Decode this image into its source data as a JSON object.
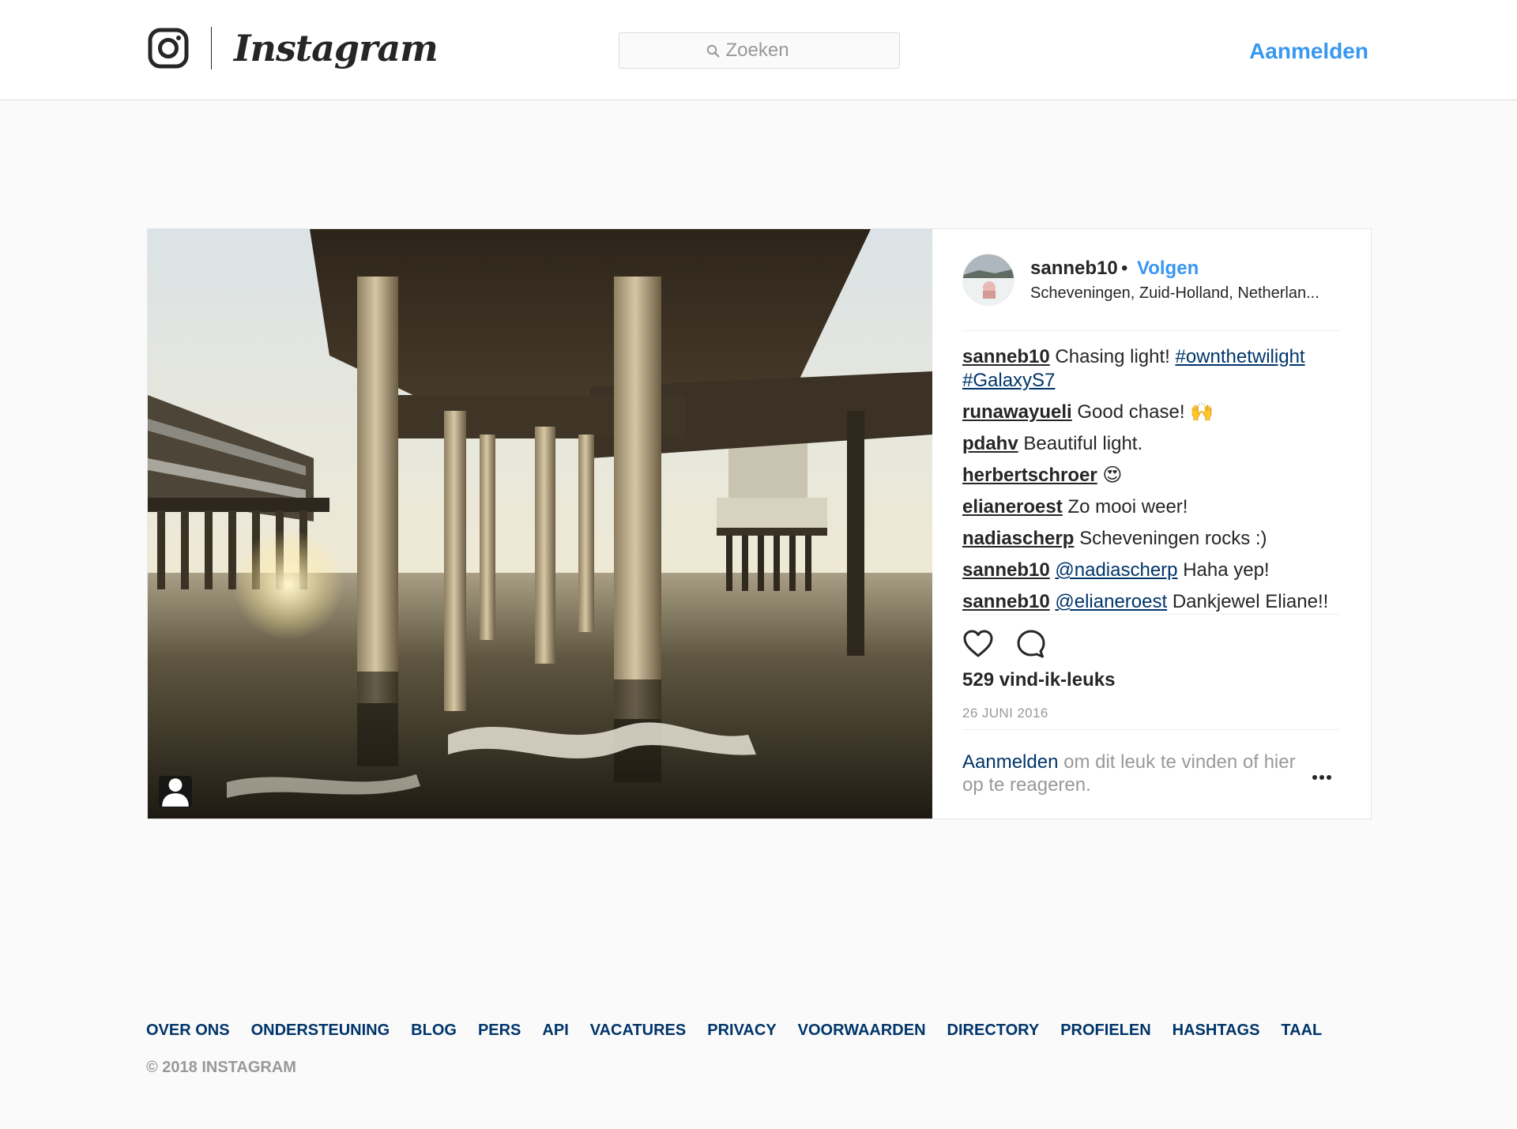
{
  "header": {
    "logo_text": "Instagram",
    "search_placeholder": "Zoeken",
    "login_label": "Aanmelden"
  },
  "post": {
    "username": "sanneb10",
    "separator": "•",
    "follow_label": "Volgen",
    "location": "Scheveningen, Zuid-Holland, Netherlan...",
    "comments": [
      {
        "user": "sanneb10",
        "text": "Chasing light!",
        "tags": [
          "#ownthetwilight",
          "#GalaxyS7"
        ]
      },
      {
        "user": "runawayueli",
        "text": "Good chase! 🙌"
      },
      {
        "user": "pdahv",
        "text": "Beautiful light."
      },
      {
        "user": "herbertschroer",
        "text": "😍"
      },
      {
        "user": "elianeroest",
        "text": "Zo mooi weer!"
      },
      {
        "user": "nadiascherp",
        "text": "Scheveningen rocks :)"
      },
      {
        "user": "sanneb10",
        "mention": "@nadiascherp",
        "text": "Haha yep!"
      },
      {
        "user": "sanneb10",
        "mention": "@elianeroest",
        "text": "Dankjewel Eliane!!"
      }
    ],
    "likes": "529 vind-ik-leuks",
    "date": "26 JUNI 2016",
    "login_link": "Aanmelden",
    "login_prompt_rest": "om dit leuk te vinden of hier op te reageren.",
    "icons": {
      "like": "heart-icon",
      "comment": "comment-bubble-icon",
      "more": "more-options-icon",
      "tagged_users": "user-tag-icon"
    }
  },
  "footer": {
    "links": [
      "OVER ONS",
      "ONDERSTEUNING",
      "BLOG",
      "PERS",
      "API",
      "VACATURES",
      "PRIVACY",
      "VOORWAARDEN",
      "DIRECTORY",
      "PROFIELEN",
      "HASHTAGS",
      "TAAL"
    ],
    "copyright": "© 2018 INSTAGRAM"
  },
  "colors": {
    "link_blue": "#3897f0",
    "dark_link": "#003569",
    "text": "#262626",
    "muted": "#999999",
    "border": "#dbdbdb",
    "background": "#fafafa"
  }
}
